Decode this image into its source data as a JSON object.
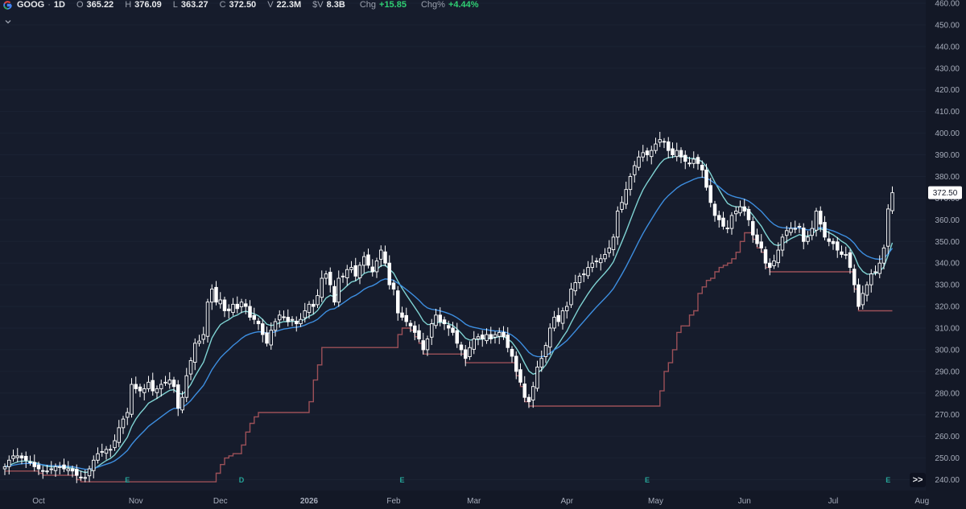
{
  "legend": {
    "symbol": "GOOG",
    "sep": "·",
    "interval": "1D",
    "open_label": "O",
    "open": "365.22",
    "high_label": "H",
    "high": "376.09",
    "low_label": "L",
    "low": "363.27",
    "close_label": "C",
    "close": "372.50",
    "volume_label": "V",
    "volume": "22.3M",
    "dollar_volume_label": "$V",
    "dollar_volume": "8.3B",
    "chg_label": "Chg",
    "chg": "+15.85",
    "chgpct_label": "Chg%",
    "chgpct": "+4.44%"
  },
  "icons": {
    "logo": "google-logo-icon",
    "collapse": "chevron-down-icon",
    "scroll": "double-chevron-right-icon"
  },
  "controls": {
    "scroll_label": ">>"
  },
  "colors": {
    "background": "#161c2c",
    "candle": "#ffffff",
    "ema_fast": "#7fd3d3",
    "ema_slow": "#3d8ee0",
    "trailing_stop": "#9c5058",
    "earnings_marker": "#26a69a",
    "price_tag_bg": "#ffffff"
  },
  "chart_data": {
    "type": "candlestick",
    "ylim": [
      235,
      460
    ],
    "y_ticks": [
      "240.00",
      "250.00",
      "260.00",
      "270.00",
      "280.00",
      "290.00",
      "300.00",
      "310.00",
      "320.00",
      "330.00",
      "340.00",
      "350.00",
      "360.00",
      "370.00",
      "380.00",
      "390.00",
      "400.00",
      "410.00",
      "420.00",
      "430.00",
      "440.00",
      "450.00",
      "460.00"
    ],
    "x_labels": [
      {
        "label": "Oct",
        "bar": 8
      },
      {
        "label": "Nov",
        "bar": 31
      },
      {
        "label": "Dec",
        "bar": 51
      },
      {
        "label": "2026",
        "bar": 72
      },
      {
        "label": "Feb",
        "bar": 92
      },
      {
        "label": "Mar",
        "bar": 111
      },
      {
        "label": "Apr",
        "bar": 133
      },
      {
        "label": "May",
        "bar": 154
      },
      {
        "label": "Jun",
        "bar": 175
      },
      {
        "label": "Jul",
        "bar": 196
      },
      {
        "label": "Aug",
        "bar": 217
      }
    ],
    "event_markers": [
      {
        "label": "E",
        "bar": 29
      },
      {
        "label": "D",
        "bar": 56
      },
      {
        "label": "E",
        "bar": 94
      },
      {
        "label": "E",
        "bar": 152
      },
      {
        "label": "E",
        "bar": 209
      }
    ],
    "last_price_label": "372.50",
    "last_price": 372.5,
    "closes": [
      246,
      249,
      251,
      251,
      250,
      249,
      248,
      246,
      245,
      244,
      244,
      245,
      246,
      246,
      245,
      245,
      244,
      242,
      241,
      241,
      245,
      249,
      252,
      253,
      254,
      254,
      258,
      264,
      268,
      271,
      284,
      282,
      281,
      282,
      285,
      281,
      282,
      284,
      285,
      286,
      283,
      273,
      278,
      288,
      295,
      303,
      304,
      307,
      322,
      328,
      322,
      323,
      318,
      318,
      321,
      319,
      322,
      320,
      315,
      314,
      312,
      307,
      303,
      309,
      313,
      316,
      315,
      313,
      314,
      312,
      314,
      318,
      321,
      320,
      325,
      333,
      335,
      330,
      322,
      333,
      334,
      337,
      338,
      334,
      339,
      343,
      339,
      336,
      341,
      346,
      340,
      330,
      328,
      317,
      315,
      313,
      311,
      308,
      305,
      300,
      305,
      312,
      316,
      313,
      312,
      310,
      308,
      303,
      300,
      296,
      301,
      305,
      306,
      305,
      307,
      305,
      307,
      308,
      306,
      301,
      297,
      290,
      285,
      278,
      276,
      283,
      292,
      296,
      302,
      310,
      315,
      313,
      318,
      320,
      328,
      331,
      334,
      335,
      338,
      340,
      341,
      342,
      344,
      347,
      352,
      364,
      368,
      374,
      380,
      385,
      389,
      391,
      390,
      392,
      395,
      397,
      396,
      392,
      390,
      392,
      389,
      387,
      386,
      388,
      386,
      383,
      375,
      368,
      362,
      360,
      357,
      356,
      362,
      364,
      366,
      364,
      360,
      353,
      349,
      347,
      340,
      338,
      341,
      346,
      352,
      355,
      356,
      356,
      357,
      350,
      352,
      356,
      364,
      358,
      352,
      350,
      349,
      346,
      344,
      344,
      338,
      330,
      320,
      326,
      330,
      335,
      336,
      340,
      347,
      365,
      372.5
    ]
  }
}
